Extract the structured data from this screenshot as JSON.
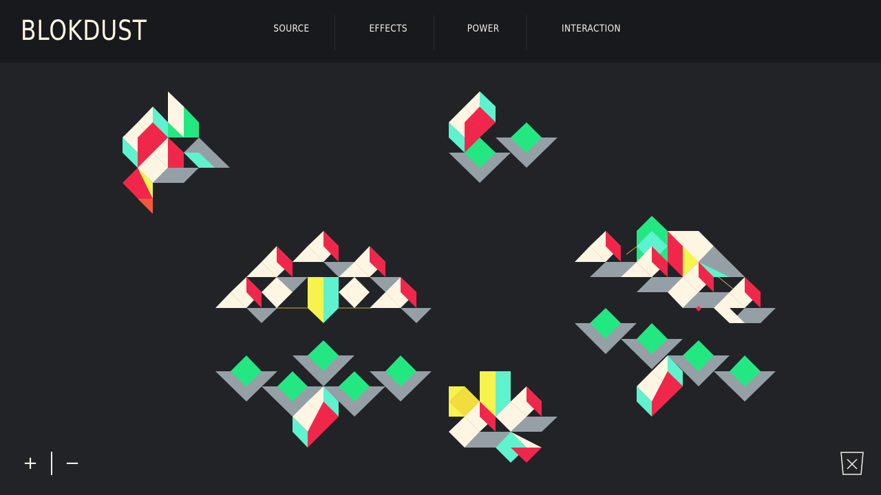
{
  "app": {
    "title": "BLOKDUST"
  },
  "nav": {
    "items": [
      {
        "label": "SOURCE"
      },
      {
        "label": "EFFECTS"
      },
      {
        "label": "POWER"
      },
      {
        "label": "INTERACTION"
      }
    ]
  },
  "zoom": {
    "in_label": "+",
    "out_label": "−"
  },
  "colors": {
    "background": "#222327",
    "header": "#18191c",
    "cream": "#fff5e3",
    "red": "#f0274b",
    "mint": "#5ff2cf",
    "grey": "#94a0a6",
    "green": "#23e882",
    "yellow": "#f6f34c",
    "orange": "#f25a3a"
  },
  "icons": {
    "close": "close-icon"
  }
}
